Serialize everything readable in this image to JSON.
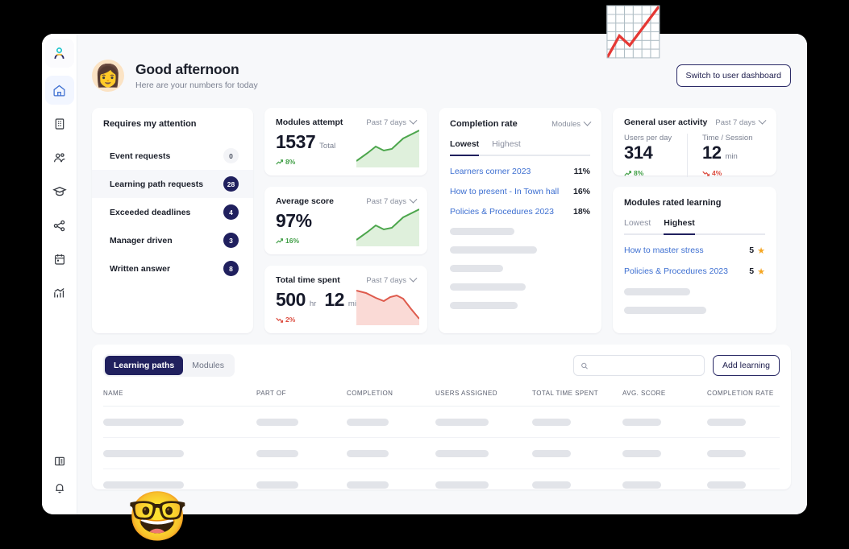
{
  "sidebar": {
    "items": [
      {
        "name": "user-avatar",
        "icon": "avatar-icon",
        "active": false
      },
      {
        "name": "home",
        "icon": "home-icon",
        "active": true
      },
      {
        "name": "company",
        "icon": "building-icon",
        "active": false
      },
      {
        "name": "people",
        "icon": "people-icon",
        "active": false
      },
      {
        "name": "learning",
        "icon": "graduation-cap-icon",
        "active": false
      },
      {
        "name": "share",
        "icon": "share-icon",
        "active": false
      },
      {
        "name": "calendar",
        "icon": "calendar-icon",
        "active": false
      },
      {
        "name": "reports",
        "icon": "chart-icon",
        "active": false
      }
    ],
    "bottom_items": [
      {
        "name": "layout",
        "icon": "panel-icon"
      },
      {
        "name": "notifications",
        "icon": "bell-icon"
      }
    ]
  },
  "header": {
    "avatar_emoji": "👩",
    "title": "Good afternoon",
    "subtitle": "Here are your numbers for today",
    "switch_button": "Switch to user dashboard"
  },
  "decorations": {
    "chart_emoji": "📈",
    "nerd_emoji": "🤓"
  },
  "attention": {
    "title": "Requires my attention",
    "items": [
      {
        "label": "Event requests",
        "count": "0",
        "selected": false,
        "zero": true
      },
      {
        "label": "Learning path requests",
        "count": "28",
        "selected": true,
        "zero": false
      },
      {
        "label": "Exceeded deadlines",
        "count": "4",
        "selected": false,
        "zero": false
      },
      {
        "label": "Manager driven",
        "count": "3",
        "selected": false,
        "zero": false
      },
      {
        "label": "Written answer",
        "count": "8",
        "selected": false,
        "zero": false
      }
    ]
  },
  "metrics": [
    {
      "title": "Modules attempt",
      "range": "Past 7 days",
      "value": "1537",
      "unit": "Total",
      "value2": "",
      "unit2": "",
      "delta": "8%",
      "direction": "up"
    },
    {
      "title": "Average score",
      "range": "Past 7 days",
      "value": "97%",
      "unit": "",
      "value2": "",
      "unit2": "",
      "delta": "16%",
      "direction": "up"
    },
    {
      "title": "Total time spent",
      "range": "Past 7 days",
      "value": "500",
      "unit": "hr",
      "value2": "12",
      "unit2": "min",
      "delta": "2%",
      "direction": "down"
    }
  ],
  "completion": {
    "title": "Completion rate",
    "filter": "Modules",
    "tabs": [
      {
        "label": "Lowest",
        "active": true
      },
      {
        "label": "Highest",
        "active": false
      }
    ],
    "rows": [
      {
        "name": "Learners corner 2023",
        "value": "11%"
      },
      {
        "name": "How to present - In Town hall",
        "value": "16%"
      },
      {
        "name": "Policies & Procedures 2023",
        "value": "18%"
      }
    ],
    "placeholder_widths": [
      "46%",
      "62%",
      "38%",
      "54%",
      "48%"
    ]
  },
  "activity": {
    "title": "General user activity",
    "range": "Past 7 days",
    "left": {
      "label": "Users per day",
      "value": "314",
      "unit": "",
      "delta": "8%",
      "direction": "up"
    },
    "right": {
      "label": "Time / Session",
      "value": "12",
      "unit": "min",
      "delta": "4%",
      "direction": "down"
    }
  },
  "rated": {
    "title": "Modules rated learning",
    "tabs": [
      {
        "label": "Lowest",
        "active": false
      },
      {
        "label": "Highest",
        "active": true
      }
    ],
    "rows": [
      {
        "name": "How to master stress",
        "value": "5",
        "star": "★"
      },
      {
        "name": "Policies & Procedures 2023",
        "value": "5",
        "star": "★"
      }
    ],
    "placeholder_widths": [
      "47%",
      "58%"
    ]
  },
  "table": {
    "pills": [
      {
        "label": "Learning paths",
        "active": true
      },
      {
        "label": "Modules",
        "active": false
      }
    ],
    "search_placeholder": "",
    "search_value": "",
    "add_button": "Add learning",
    "columns": [
      "NAME",
      "PART OF",
      "COMPLETION",
      "USERS ASSIGNED",
      "TOTAL TIME SPENT",
      "AVG. SCORE",
      "COMPLETION RATE"
    ],
    "rows": [
      {
        "widths": [
          "100px",
          "52px",
          "52px",
          "66px",
          "48px",
          "48px",
          "48px"
        ],
        "has_delete": true
      },
      {
        "widths": [
          "100px",
          "52px",
          "52px",
          "66px",
          "48px",
          "48px",
          "48px"
        ],
        "has_delete": true
      },
      {
        "widths": [
          "100px",
          "52px",
          "52px",
          "66px",
          "48px",
          "48px",
          "48px"
        ],
        "has_delete": false
      }
    ]
  },
  "colors": {
    "navy": "#20205e",
    "link_blue": "#3d6fd1",
    "green": "#3f9e45",
    "red": "#dc4b3e",
    "star_orange": "#f5a623",
    "page_bg": "#f7f8fa"
  }
}
